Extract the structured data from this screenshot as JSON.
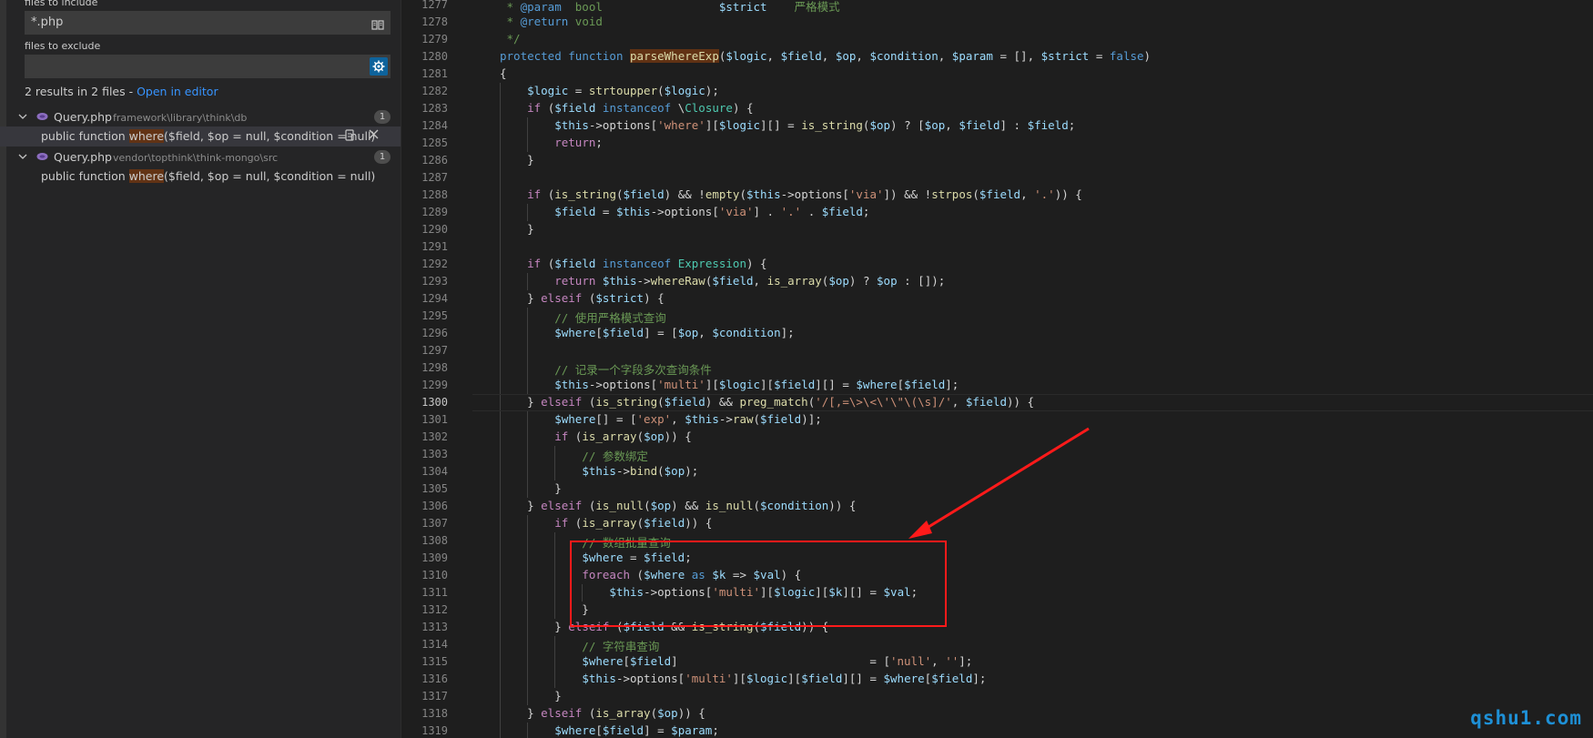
{
  "search": {
    "include_label": "files to include",
    "include_value": "*.php",
    "exclude_label": "files to exclude",
    "exclude_value": "",
    "results_text": "2 results in 2 files - ",
    "open_in_editor": "Open in editor"
  },
  "results": [
    {
      "file": "Query.php",
      "path": "framework\\library\\think\\db",
      "count": "1",
      "match_prefix": "public function ",
      "match_hl": "where",
      "match_suffix": "($field, $op = null, $condition = null)"
    },
    {
      "file": "Query.php",
      "path": "vendor\\topthink\\think-mongo\\src",
      "count": "1",
      "match_prefix": "public function ",
      "match_hl": "where",
      "match_suffix": "($field, $op = null, $condition = null)"
    }
  ],
  "editor": {
    "current_line": 1300,
    "lines": [
      {
        "n": 1277,
        "t": " * @param  bool                 $strict    严格模式"
      },
      {
        "n": 1278,
        "t": " * @return void"
      },
      {
        "n": 1279,
        "t": " */"
      },
      {
        "n": 1280,
        "t": "protected function parseWhereExp($logic, $field, $op, $condition, $param = [], $strict = false)"
      },
      {
        "n": 1281,
        "t": "{"
      },
      {
        "n": 1282,
        "t": "    $logic = strtoupper($logic);"
      },
      {
        "n": 1283,
        "t": "    if ($field instanceof \\Closure) {"
      },
      {
        "n": 1284,
        "t": "        $this->options['where'][$logic][] = is_string($op) ? [$op, $field] : $field;"
      },
      {
        "n": 1285,
        "t": "        return;"
      },
      {
        "n": 1286,
        "t": "    }"
      },
      {
        "n": 1287,
        "t": ""
      },
      {
        "n": 1288,
        "t": "    if (is_string($field) && !empty($this->options['via']) && !strpos($field, '.')) {"
      },
      {
        "n": 1289,
        "t": "        $field = $this->options['via'] . '.' . $field;"
      },
      {
        "n": 1290,
        "t": "    }"
      },
      {
        "n": 1291,
        "t": ""
      },
      {
        "n": 1292,
        "t": "    if ($field instanceof Expression) {"
      },
      {
        "n": 1293,
        "t": "        return $this->whereRaw($field, is_array($op) ? $op : []);"
      },
      {
        "n": 1294,
        "t": "    } elseif ($strict) {"
      },
      {
        "n": 1295,
        "t": "        // 使用严格模式查询"
      },
      {
        "n": 1296,
        "t": "        $where[$field] = [$op, $condition];"
      },
      {
        "n": 1297,
        "t": ""
      },
      {
        "n": 1298,
        "t": "        // 记录一个字段多次查询条件"
      },
      {
        "n": 1299,
        "t": "        $this->options['multi'][$logic][$field][] = $where[$field];"
      },
      {
        "n": 1300,
        "t": "    } elseif (is_string($field) && preg_match('/[,=\\>\\<\\'\\\"\\(\\s]/', $field)) {"
      },
      {
        "n": 1301,
        "t": "        $where[] = ['exp', $this->raw($field)];"
      },
      {
        "n": 1302,
        "t": "        if (is_array($op)) {"
      },
      {
        "n": 1303,
        "t": "            // 参数绑定"
      },
      {
        "n": 1304,
        "t": "            $this->bind($op);"
      },
      {
        "n": 1305,
        "t": "        }"
      },
      {
        "n": 1306,
        "t": "    } elseif (is_null($op) && is_null($condition)) {"
      },
      {
        "n": 1307,
        "t": "        if (is_array($field)) {"
      },
      {
        "n": 1308,
        "t": "            // 数组批量查询"
      },
      {
        "n": 1309,
        "t": "            $where = $field;"
      },
      {
        "n": 1310,
        "t": "            foreach ($where as $k => $val) {"
      },
      {
        "n": 1311,
        "t": "                $this->options['multi'][$logic][$k][] = $val;"
      },
      {
        "n": 1312,
        "t": "            }"
      },
      {
        "n": 1313,
        "t": "        } elseif ($field && is_string($field)) {"
      },
      {
        "n": 1314,
        "t": "            // 字符串查询"
      },
      {
        "n": 1315,
        "t": "            $where[$field]                            = ['null', ''];"
      },
      {
        "n": 1316,
        "t": "            $this->options['multi'][$logic][$field][] = $where[$field];"
      },
      {
        "n": 1317,
        "t": "        }"
      },
      {
        "n": 1318,
        "t": "    } elseif (is_array($op)) {"
      },
      {
        "n": 1319,
        "t": "        $where[$field] = $param;"
      }
    ]
  },
  "watermark": "qshu1.com",
  "colors": {
    "keyword": "#569cd6",
    "string": "#ce9178",
    "variable": "#9cdcfe",
    "function": "#dcdcaa",
    "comment": "#6a9955",
    "type": "#4ec9b0",
    "annotation": "#ff1a1a",
    "link": "#3794ff"
  }
}
